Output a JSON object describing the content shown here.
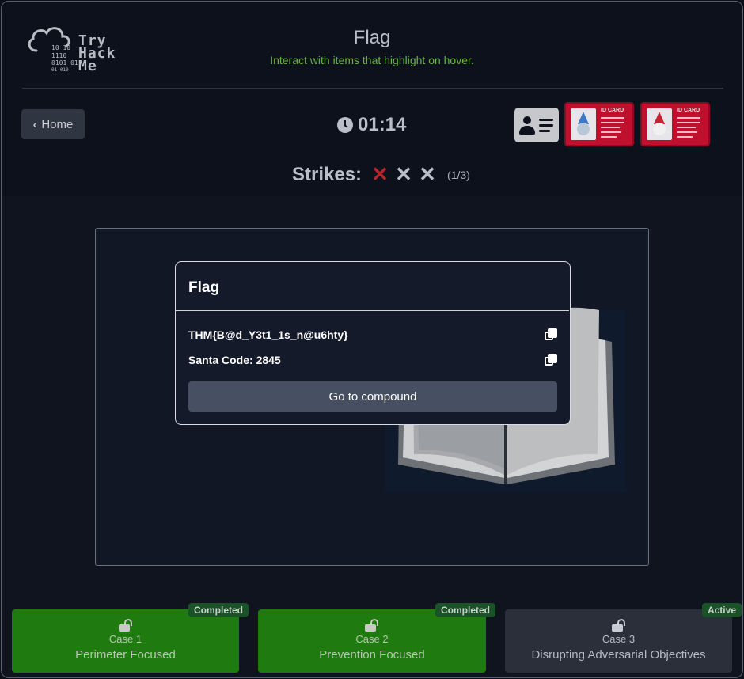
{
  "brand": {
    "logo_text": "Try\nHack\nMe",
    "binary": [
      "10  10",
      "1110",
      "0101  01",
      "01  010"
    ]
  },
  "header": {
    "title": "Flag",
    "subtitle": "Interact with items that highlight on hover."
  },
  "toolbar": {
    "home_label": "Home",
    "timer": "01:14"
  },
  "id_cards": [
    {
      "header": "ID CARD",
      "figure": "gnome-blue"
    },
    {
      "header": "ID CARD",
      "figure": "santa"
    }
  ],
  "strikes": {
    "label": "Strikes:",
    "count_text": "(1/3)",
    "used": 1,
    "total": 3,
    "used_color": "#b3262c",
    "unused_color": "#b9bec8"
  },
  "modal": {
    "title": "Flag",
    "flag": "THM{B@d_Y3t1_1s_n@u6hty}",
    "santa_code": "Santa Code: 2845",
    "button_label": "Go to compound"
  },
  "cases": [
    {
      "number": "Case 1",
      "name": "Perimeter Focused",
      "status": "Completed"
    },
    {
      "number": "Case 2",
      "name": "Prevention Focused",
      "status": "Completed"
    },
    {
      "number": "Case 3",
      "name": "Disrupting Adversarial Objectives",
      "status": "Active"
    }
  ],
  "colors": {
    "accent_green": "#69b43c",
    "completed": "#1f7a0f",
    "id_card_red": "#c0102e"
  }
}
